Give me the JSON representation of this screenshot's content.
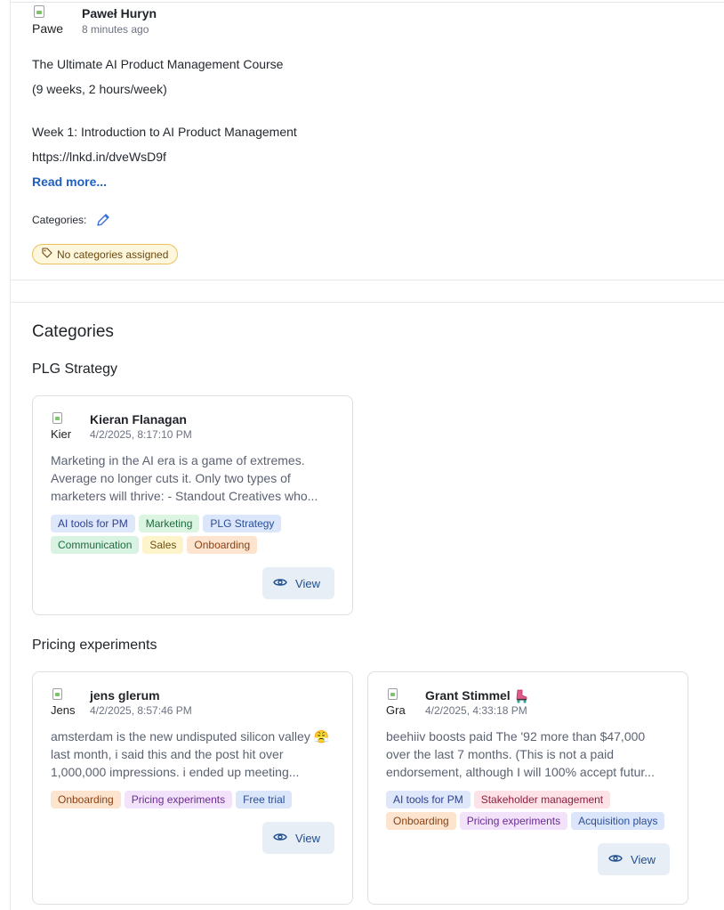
{
  "post": {
    "avatar_alt": "Pawe",
    "author": "Paweł Huryn",
    "time": "8 minutes ago",
    "lines": [
      "The Ultimate AI Product Management Course",
      "(9 weeks, 2 hours/week)",
      "Week 1: Introduction to AI Product Management",
      "https://lnkd.in/dveWsD9f"
    ],
    "read_more": "Read more...",
    "categories_label": "Categories:",
    "no_categories": "No categories assigned"
  },
  "categories_heading": "Categories",
  "groups": [
    {
      "title": "PLG Strategy",
      "cards": [
        {
          "avatar_alt": "Kier",
          "author": "Kieran Flanagan",
          "time": "4/2/2025, 8:17:10 PM",
          "text": "Marketing in the AI era is a game of extremes. Average no longer cuts it. Only two types of marketers will thrive: - Standout Creatives who...",
          "tags": [
            "AI tools for PM",
            "Marketing",
            "PLG Strategy",
            "Communication",
            "Sales",
            "Onboarding"
          ],
          "view_label": "View"
        }
      ]
    },
    {
      "title": "Pricing experiments",
      "cards": [
        {
          "avatar_alt": "Jens",
          "author": "jens glerum",
          "time": "4/2/2025, 8:57:46 PM",
          "text": "amsterdam is the new undisputed silicon valley 😤 last month, i said this and the post hit over 1,000,000 impressions. i ended up meeting...",
          "tags": [
            "Onboarding",
            "Pricing experiments",
            "Free trial"
          ],
          "view_label": "View"
        },
        {
          "avatar_alt": "Gra",
          "author": "Grant Stimmel",
          "author_emoji": "roller-skate-icon",
          "time": "4/2/2025, 4:33:18 PM",
          "text": "beehiiv boosts paid The '92 more than $47,000 over the last 7 months. (This is not a paid endorsement, although I will 100% accept futur...",
          "tags": [
            "AI tools for PM",
            "Stakeholder management",
            "Onboarding",
            "Pricing experiments",
            "Acquisition plays"
          ],
          "view_label": "View"
        }
      ]
    }
  ],
  "tag_colors": {
    "AI tools for PM": {
      "bg": "#dfe7fb",
      "fg": "#2d3f8e"
    },
    "Marketing": {
      "bg": "#dcf5e3",
      "fg": "#1d6b3a"
    },
    "PLG Strategy": {
      "bg": "#dbe6fb",
      "fg": "#2b4f9a"
    },
    "Communication": {
      "bg": "#d9f3e2",
      "fg": "#1f6b40"
    },
    "Sales": {
      "bg": "#fdf4cc",
      "fg": "#6d5210"
    },
    "Onboarding": {
      "bg": "#fde4cf",
      "fg": "#8a4215"
    },
    "Pricing experiments": {
      "bg": "#f2e3fb",
      "fg": "#6b2b93"
    },
    "Free trial": {
      "bg": "#dbe6fb",
      "fg": "#2b4f9a"
    },
    "Stakeholder management": {
      "bg": "#fde3e8",
      "fg": "#8e1f3e"
    },
    "Acquisition plays": {
      "bg": "#dbe6fb",
      "fg": "#2b4f9a"
    }
  }
}
